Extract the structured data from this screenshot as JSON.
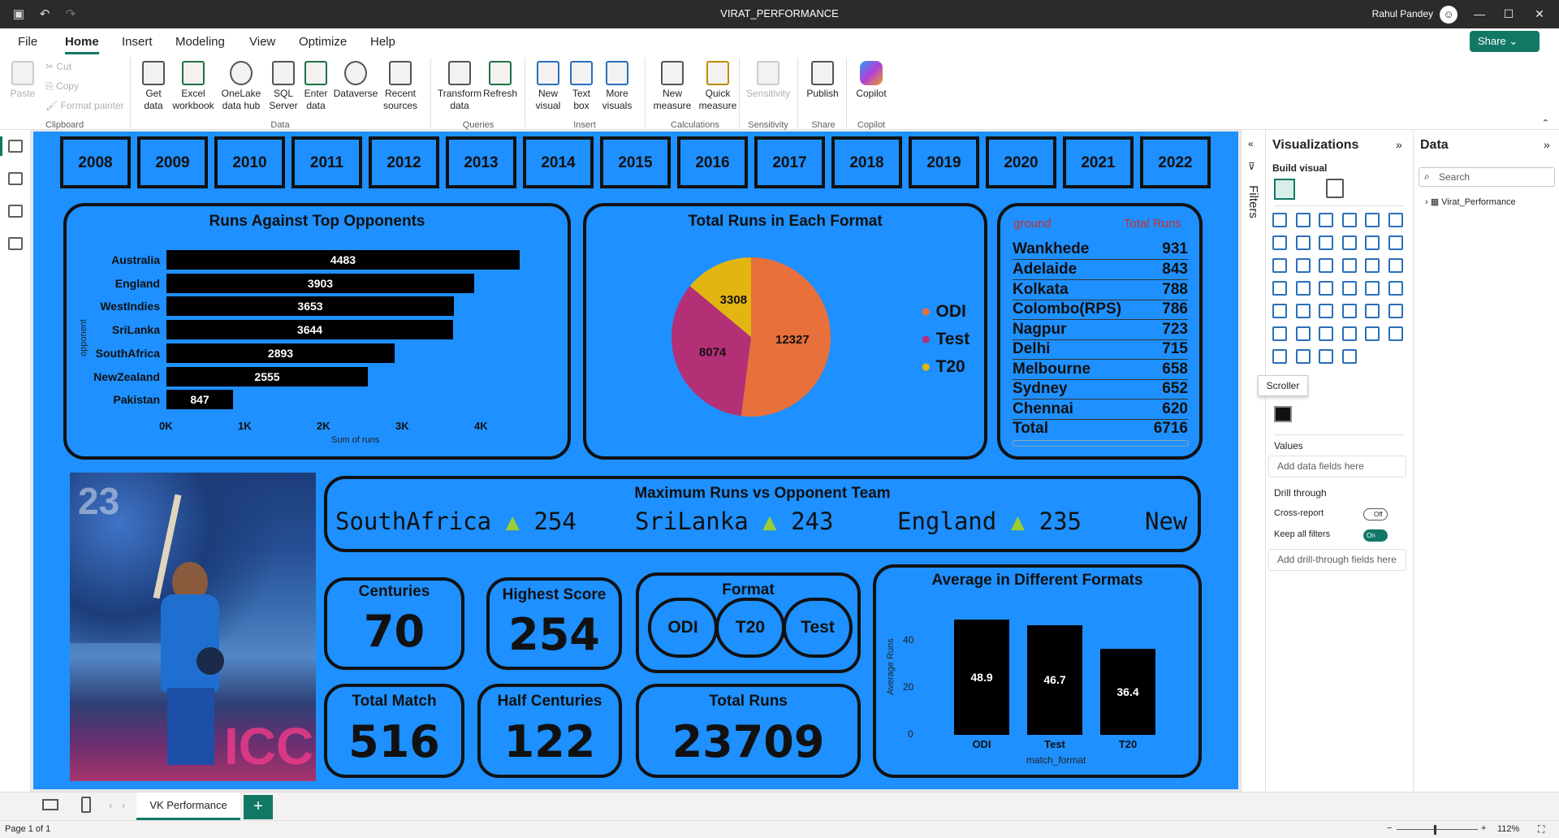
{
  "window": {
    "title": "VIRAT_PERFORMANCE",
    "user": "Rahul Pandey"
  },
  "menu": {
    "items": [
      "File",
      "Home",
      "Insert",
      "Modeling",
      "View",
      "Optimize",
      "Help"
    ],
    "active": "Home",
    "share_label": "Share"
  },
  "ribbon": {
    "clipboard": {
      "paste": "Paste",
      "cut": "Cut",
      "copy": "Copy",
      "format_painter": "Format painter",
      "group": "Clipboard"
    },
    "data": {
      "get_data": "Get data",
      "excel": "Excel workbook",
      "onelake": "OneLake data hub",
      "sql": "SQL Server",
      "enter": "Enter data",
      "dataverse": "Dataverse",
      "recent": "Recent sources",
      "group": "Data"
    },
    "queries": {
      "transform": "Transform data",
      "refresh": "Refresh",
      "group": "Queries"
    },
    "insert": {
      "new_visual": "New visual",
      "text_box": "Text box",
      "more_visuals": "More visuals",
      "group": "Insert"
    },
    "calculations": {
      "new_measure": "New measure",
      "quick_measure": "Quick measure",
      "group": "Calculations"
    },
    "sensitivity": {
      "label": "Sensitivity",
      "group": "Sensitivity"
    },
    "share": {
      "publish": "Publish",
      "group": "Share"
    },
    "copilot": {
      "label": "Copilot",
      "group": "Copilot"
    }
  },
  "report": {
    "years": [
      "2008",
      "2009",
      "2010",
      "2011",
      "2012",
      "2013",
      "2014",
      "2015",
      "2016",
      "2017",
      "2018",
      "2019",
      "2020",
      "2021",
      "2022"
    ],
    "bar_chart": {
      "title": "Runs Against Top Opponents",
      "ylabel": "opponent",
      "xlabel": "Sum of runs",
      "ticks": [
        "0K",
        "1K",
        "2K",
        "3K",
        "4K"
      ]
    },
    "pie": {
      "title": "Total Runs in Each Format",
      "legend": [
        "ODI",
        "Test",
        "T20"
      ]
    },
    "ground_table": {
      "col1": "ground",
      "col2": "Total Runs",
      "rows": [
        {
          "g": "Wankhede",
          "v": "931"
        },
        {
          "g": "Adelaide",
          "v": "843"
        },
        {
          "g": "Kolkata",
          "v": "788"
        },
        {
          "g": "Colombo(RPS)",
          "v": "786"
        },
        {
          "g": "Nagpur",
          "v": "723"
        },
        {
          "g": "Delhi",
          "v": "715"
        },
        {
          "g": "Melbourne",
          "v": "658"
        },
        {
          "g": "Sydney",
          "v": "652"
        },
        {
          "g": "Chennai",
          "v": "620"
        }
      ],
      "total_label": "Total",
      "total": "6716"
    },
    "scroller": {
      "title": "Maximum Runs vs Opponent Team",
      "items": [
        {
          "team": "SouthAfrica",
          "runs": "254"
        },
        {
          "team": "SriLanka",
          "runs": "243"
        },
        {
          "team": "England",
          "runs": "235"
        },
        {
          "team": "New.",
          "runs": ""
        }
      ],
      "arrow": "▲"
    },
    "cards": {
      "centuries": {
        "label": "Centuries",
        "value": "70"
      },
      "highest": {
        "label": "Highest Score",
        "value": "254"
      },
      "format": {
        "label": "Format",
        "options": [
          "ODI",
          "T20",
          "Test"
        ]
      },
      "matches": {
        "label": "Total Match",
        "value": "516"
      },
      "half": {
        "label": "Half Centuries",
        "value": "122"
      },
      "runs": {
        "label": "Total Runs",
        "value": "23709"
      }
    },
    "avg_chart": {
      "title": "Average in Different Formats",
      "ylabel": "Average Runs",
      "xlabel": "match_format",
      "ticks": [
        "40",
        "20",
        "0"
      ]
    }
  },
  "chart_data": [
    {
      "type": "bar",
      "title": "Runs Against Top Opponents",
      "categories": [
        "Australia",
        "England",
        "WestIndies",
        "SriLanka",
        "SouthAfrica",
        "NewZealand",
        "Pakistan"
      ],
      "values": [
        4483,
        3903,
        3653,
        3644,
        2893,
        2555,
        847
      ],
      "xlabel": "Sum of runs",
      "ylabel": "opponent",
      "xlim": [
        0,
        4500
      ]
    },
    {
      "type": "pie",
      "title": "Total Runs in Each Format",
      "categories": [
        "ODI",
        "Test",
        "T20"
      ],
      "values": [
        12327,
        8074,
        3308
      ],
      "colors": [
        "#e8703a",
        "#b33077",
        "#e2b512"
      ]
    },
    {
      "type": "bar",
      "title": "Average in Different Formats",
      "categories": [
        "ODI",
        "Test",
        "T20"
      ],
      "values": [
        48.9,
        46.7,
        36.4
      ],
      "xlabel": "match_format",
      "ylabel": "Average Runs",
      "ylim": [
        0,
        50
      ]
    }
  ],
  "filters": {
    "label": "Filters"
  },
  "viz": {
    "title": "Visualizations",
    "build": "Build visual",
    "tooltip": "Scroller",
    "values": "Values",
    "add_fields": "Add data fields here",
    "drill": "Drill through",
    "cross": "Cross-report",
    "cross_state": "Off",
    "keep": "Keep all filters",
    "keep_state": "On",
    "add_drill": "Add drill-through fields here"
  },
  "data_pane": {
    "title": "Data",
    "search_placeholder": "Search",
    "table": "Virat_Performance"
  },
  "tabs": {
    "page": "VK Performance"
  },
  "status": {
    "page": "Page 1 of 1",
    "zoom": "112%"
  }
}
